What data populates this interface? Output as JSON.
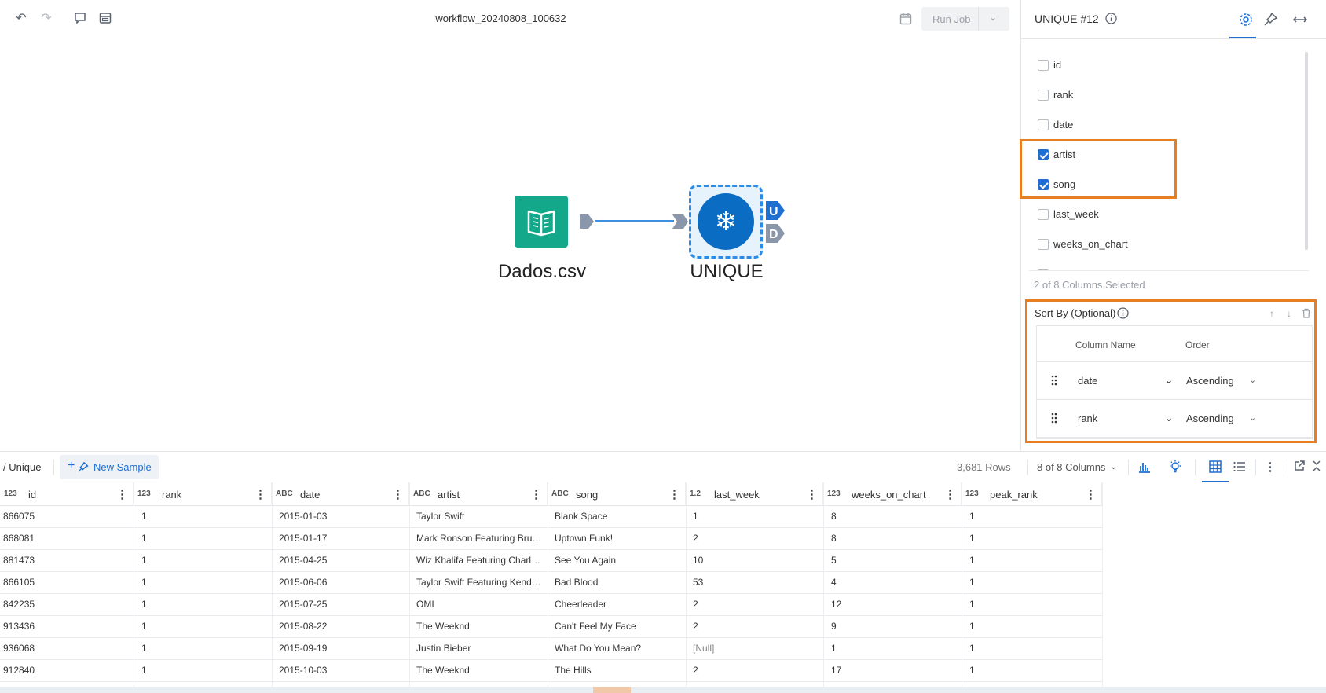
{
  "workflow": {
    "title": "workflow_20240808_100632"
  },
  "toolbar": {
    "run_job_label": "Run Job"
  },
  "canvas": {
    "source_node_label": "Dados.csv",
    "unique_node_label": "UNIQUE",
    "unique_out_u": "U",
    "unique_out_d": "D"
  },
  "panel": {
    "title": "UNIQUE #12",
    "columns": [
      {
        "name": "id",
        "checked": false
      },
      {
        "name": "rank",
        "checked": false
      },
      {
        "name": "date",
        "checked": false
      },
      {
        "name": "artist",
        "checked": true
      },
      {
        "name": "song",
        "checked": true
      },
      {
        "name": "last_week",
        "checked": false
      },
      {
        "name": "weeks_on_chart",
        "checked": false
      },
      {
        "name": "peak_rank",
        "checked": false
      }
    ],
    "selected_count": "2 of 8 Columns Selected",
    "sort": {
      "title": "Sort By (Optional)",
      "col_header": "Column Name",
      "order_header": "Order",
      "rows": [
        {
          "column": "date",
          "order": "Ascending"
        },
        {
          "column": "rank",
          "order": "Ascending"
        }
      ]
    }
  },
  "preview": {
    "breadcrumb": "/ Unique",
    "new_sample": "New Sample",
    "rows": "3,681 Rows",
    "columns": "8 of 8 Columns"
  },
  "grid": {
    "headers": [
      {
        "type": "123",
        "name": "id"
      },
      {
        "type": "123",
        "name": "rank"
      },
      {
        "type": "ABC",
        "name": "date"
      },
      {
        "type": "ABC",
        "name": "artist"
      },
      {
        "type": "ABC",
        "name": "song"
      },
      {
        "type": "1.2",
        "name": "last_week"
      },
      {
        "type": "123",
        "name": "weeks_on_chart"
      },
      {
        "type": "123",
        "name": "peak_rank"
      }
    ],
    "rows": [
      [
        "866075",
        "1",
        "2015-01-03",
        "Taylor Swift",
        "Blank Space",
        "1",
        "8",
        "1"
      ],
      [
        "868081",
        "1",
        "2015-01-17",
        "Mark Ronson Featuring Brun...",
        "Uptown Funk!",
        "2",
        "8",
        "1"
      ],
      [
        "881473",
        "1",
        "2015-04-25",
        "Wiz Khalifa Featuring Charlie...",
        "See You Again",
        "10",
        "5",
        "1"
      ],
      [
        "866105",
        "1",
        "2015-06-06",
        "Taylor Swift Featuring Kendri...",
        "Bad Blood",
        "53",
        "4",
        "1"
      ],
      [
        "842235",
        "1",
        "2015-07-25",
        "OMI",
        "Cheerleader",
        "2",
        "12",
        "1"
      ],
      [
        "913436",
        "1",
        "2015-08-22",
        "The Weeknd",
        "Can't Feel My Face",
        "2",
        "9",
        "1"
      ],
      [
        "936068",
        "1",
        "2015-09-19",
        "Justin Bieber",
        "What Do You Mean?",
        "[Null]",
        "1",
        "1"
      ],
      [
        "912840",
        "1",
        "2015-10-03",
        "The Weeknd",
        "The Hills",
        "2",
        "17",
        "1"
      ]
    ]
  },
  "colors": {
    "accent": "#1f6fd1",
    "highlight": "#e67e22",
    "csv_node": "#14a88a",
    "unique_node": "#0b6cc4"
  }
}
